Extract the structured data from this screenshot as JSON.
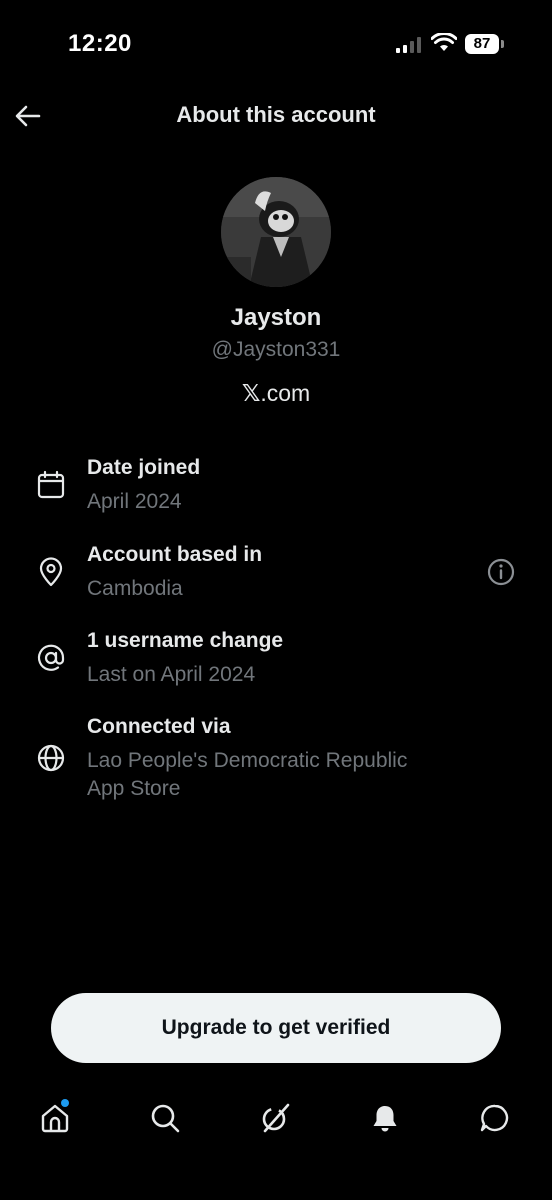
{
  "status_bar": {
    "time": "12:20",
    "battery": "87",
    "signal_icon": "cellular-signal-icon",
    "wifi_icon": "wifi-icon"
  },
  "header": {
    "title": "About this account",
    "back_icon": "arrow-left-icon"
  },
  "profile": {
    "display_name": "Jayston",
    "handle": "@Jayston331",
    "site_logo": "𝕏",
    "site_suffix": ".com"
  },
  "details": [
    {
      "icon": "calendar-icon",
      "title": "Date joined",
      "value": "April 2024"
    },
    {
      "icon": "location-pin-icon",
      "title": "Account based in",
      "value": "Cambodia",
      "info_icon": "info-circle-icon"
    },
    {
      "icon": "at-sign-icon",
      "title": "1 username change",
      "value": "Last on April 2024"
    },
    {
      "icon": "globe-icon",
      "title": "Connected via",
      "value": "Lao People's Democratic Republic",
      "value_line2": "App Store"
    }
  ],
  "cta": {
    "label": "Upgrade to get verified"
  },
  "bottom_nav": [
    {
      "icon": "home-icon",
      "has_dot": true
    },
    {
      "icon": "search-icon"
    },
    {
      "icon": "grok-icon"
    },
    {
      "icon": "bell-icon"
    },
    {
      "icon": "messages-icon"
    }
  ],
  "colors": {
    "background": "#000000",
    "primary_text": "#e7e9ea",
    "secondary_text": "#71767b",
    "button_bg": "#eff3f4",
    "accent_dot": "#1d9bf0"
  }
}
